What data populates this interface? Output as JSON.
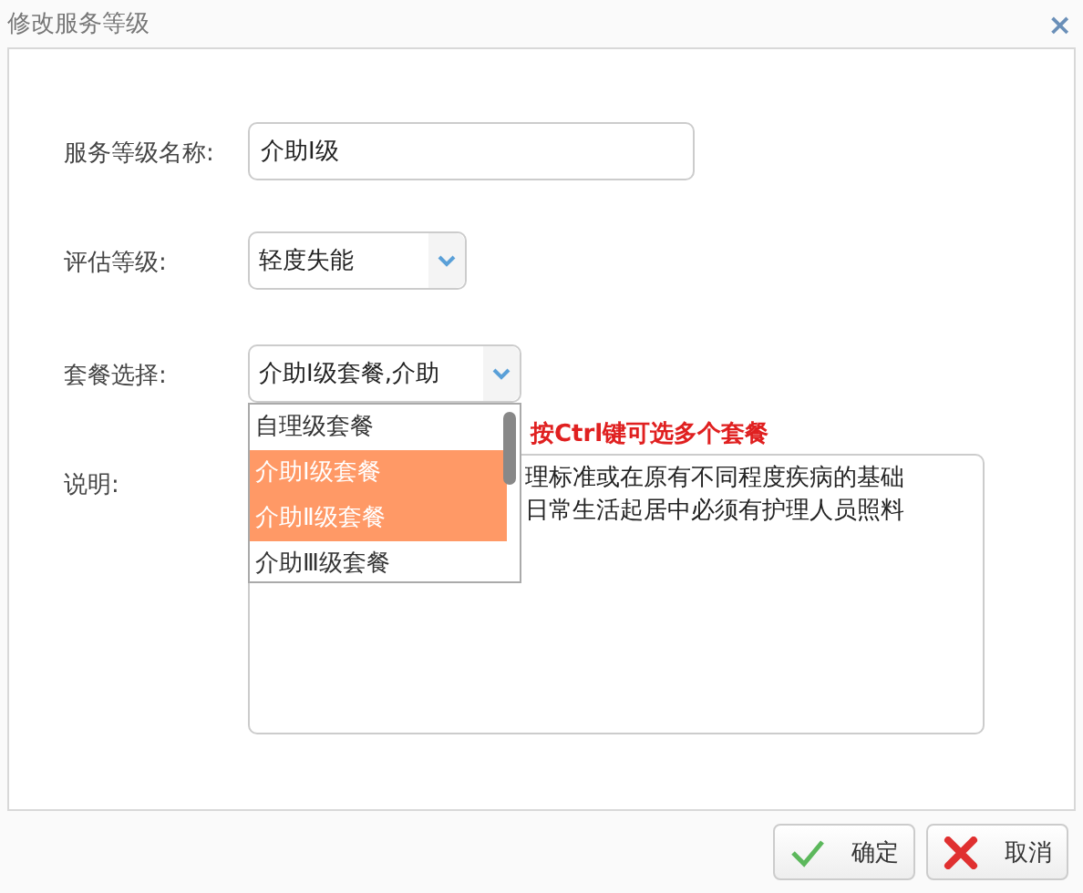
{
  "window": {
    "title": "修改服务等级",
    "close": "×"
  },
  "form": {
    "name_label": "服务等级名称:",
    "name_value": "介助Ⅰ级",
    "level_label": "评估等级:",
    "level_value": "轻度失能",
    "package_label": "套餐选择:",
    "package_value": "介助Ⅰ级套餐,介助",
    "package_options": [
      {
        "label": "自理级套餐",
        "selected": false
      },
      {
        "label": "介助Ⅰ级套餐",
        "selected": true
      },
      {
        "label": "介助Ⅱ级套餐",
        "selected": true
      },
      {
        "label": "介助Ⅲ级套餐",
        "selected": false
      }
    ],
    "hint": "按Ctrl键可选多个套餐",
    "description_label": "说明:",
    "description_lines": [
      "理标准或在原有不同程度疾病的基础",
      "日常生活起居中必须有护理人员照料"
    ]
  },
  "buttons": [
    {
      "kind": "confirm",
      "label": "确定"
    },
    {
      "kind": "cancel",
      "label": "取消"
    }
  ]
}
